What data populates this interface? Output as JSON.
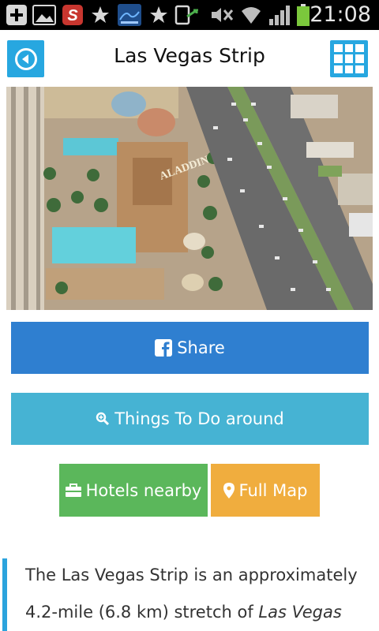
{
  "status_bar": {
    "time": "21:08",
    "icons": [
      "add-icon",
      "image-icon",
      "app-s-icon",
      "star-icon",
      "map-app-icon",
      "star-icon",
      "download-icon",
      "mute-icon",
      "wifi-icon",
      "signal-icon",
      "battery-icon"
    ],
    "battery_color": "#7bc83c"
  },
  "header": {
    "title": "Las Vegas Strip",
    "accent_color": "#27a7e0"
  },
  "photo": {
    "sign_text": "ALADDIN"
  },
  "actions": {
    "share_label": "Share",
    "things_label": "Things To Do around",
    "hotels_label": "Hotels nearby",
    "map_label": "Full Map"
  },
  "colors": {
    "share": "#2f7fd0",
    "things": "#46b3d3",
    "hotels": "#5bb75b",
    "map": "#f0ad3e"
  },
  "description": {
    "text_part1": "The Las Vegas Strip is an approximately 4.2-mile (6.8 km) stretch of ",
    "text_italic": "Las Vegas"
  }
}
